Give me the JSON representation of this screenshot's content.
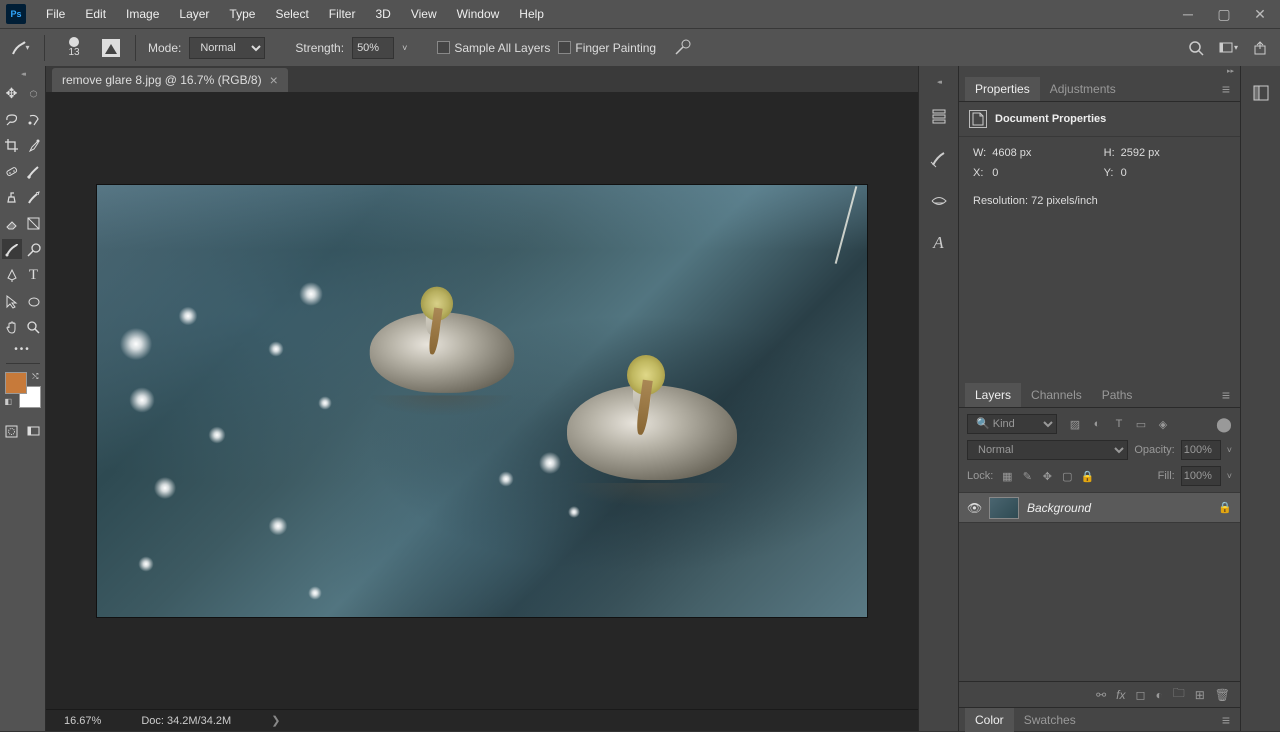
{
  "menubar": {
    "logo": "Ps",
    "items": [
      "File",
      "Edit",
      "Image",
      "Layer",
      "Type",
      "Select",
      "Filter",
      "3D",
      "View",
      "Window",
      "Help"
    ]
  },
  "optbar": {
    "brush_size": "13",
    "mode_label": "Mode:",
    "mode_value": "Normal",
    "strength_label": "Strength:",
    "strength_value": "50%",
    "sample_all": "Sample All Layers",
    "finger_paint": "Finger Painting"
  },
  "document": {
    "tab_title": "remove glare 8.jpg @ 16.7% (RGB/8)",
    "zoom_display": "16.67%",
    "doc_size": "Doc: 34.2M/34.2M"
  },
  "panels": {
    "properties_tab": "Properties",
    "adjustments_tab": "Adjustments",
    "properties_title": "Document Properties",
    "w_label": "W:",
    "w_value": "4608 px",
    "h_label": "H:",
    "h_value": "2592 px",
    "x_label": "X:",
    "x_value": "0",
    "y_label": "Y:",
    "y_value": "0",
    "resolution": "Resolution: 72 pixels/inch",
    "layers_tab": "Layers",
    "channels_tab": "Channels",
    "paths_tab": "Paths",
    "kind_label": "Kind",
    "blend_mode": "Normal",
    "opacity_label": "Opacity:",
    "opacity_value": "100%",
    "lock_label": "Lock:",
    "fill_label": "Fill:",
    "fill_value": "100%",
    "layers": [
      {
        "name": "Background",
        "locked": true,
        "visible": true
      }
    ],
    "color_tab": "Color",
    "swatches_tab": "Swatches"
  },
  "colors": {
    "foreground": "#c77a3a",
    "background": "#ffffff"
  }
}
